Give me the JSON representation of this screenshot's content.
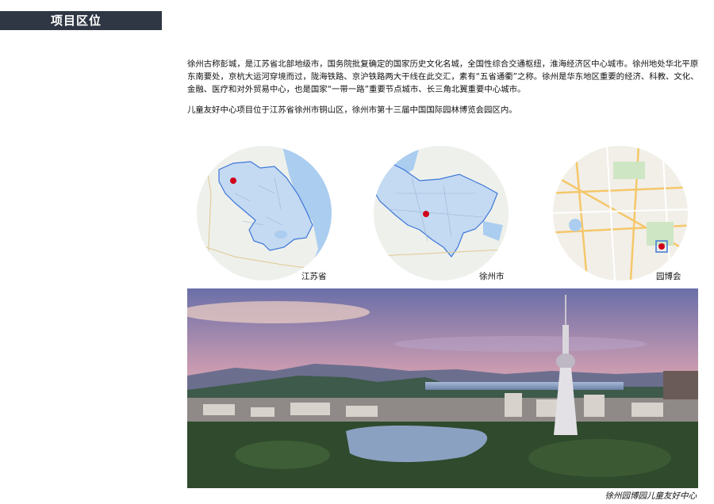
{
  "header": {
    "title": "项目区位"
  },
  "intro": {
    "paragraph1": "徐州古称彭城，是江苏省北部地级市，国务院批复确定的国家历史文化名城，全国性综合交通枢纽，淮海经济区中心城市。徐州地处华北平原东南要处，京杭大运河穿境而过，陇海铁路、京沪铁路两大干线在此交汇，素有“五省通衢”之称。徐州是华东地区重要的经济、科教、文化、金融、医疗和对外贸易中心，也是国家“一带一路”重要节点城市、长三角北翼重要中心城市。",
    "paragraph2": "儿童友好中心项目位于江苏省徐州市铜山区，徐州市第十三届中国国际园林博览会园区内。"
  },
  "maps": [
    {
      "label": "江苏省",
      "marker_color": "#d0021b"
    },
    {
      "label": "徐州市",
      "marker_color": "#d0021b"
    },
    {
      "label": "园博会",
      "marker_color": "#d0021b"
    }
  ],
  "photo": {
    "caption": "徐州园博园儿童友好中心"
  },
  "colors": {
    "header_bg": "#2f3744",
    "region_fill": "#c4d9f2",
    "region_stroke": "#3c78d8",
    "water": "#aacdf0",
    "land": "#eef0ec"
  }
}
